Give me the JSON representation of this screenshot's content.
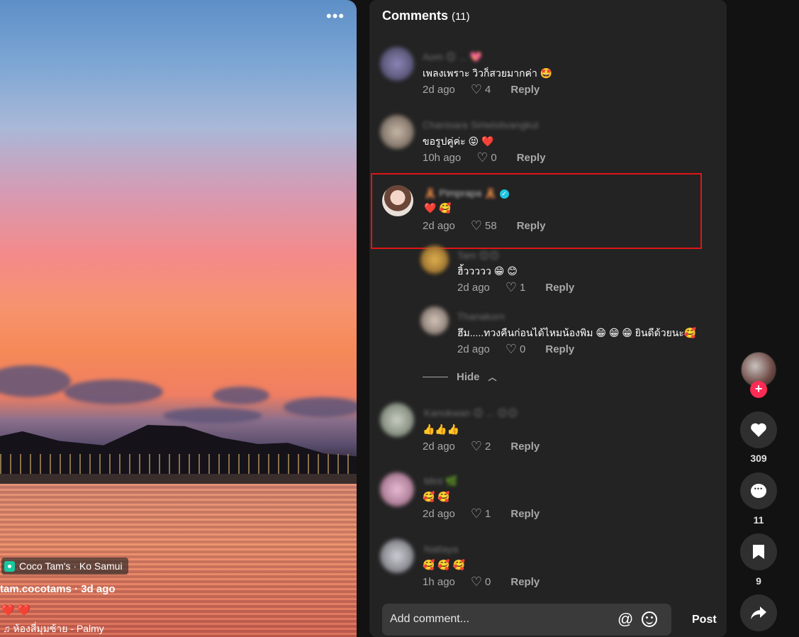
{
  "video": {
    "more_label": "•••",
    "location": "Coco Tam's · Ko Samui",
    "author": "tam.cocotams",
    "posted": " · 3d ago",
    "caption": "❤️ ❤️",
    "music": "♫  ห้องสี่มุมซ้าย - Palmy"
  },
  "comments_panel": {
    "title": "Comments",
    "count": "(11)",
    "comments": [
      {
        "username": "Aom 😊 ... 💖",
        "text": "เพลงเพราะ วิวก็สวยมากค่า 🤩",
        "time": "2d ago",
        "likes": "4",
        "reply": "Reply"
      },
      {
        "username": "Chanisara Siriwisitvangkul",
        "text": "ขอรูปคู่ค่ะ 😝 ❤️",
        "time": "10h ago",
        "likes": "0",
        "reply": "Reply"
      },
      {
        "username": "🧸 Pimprapa 🧸",
        "text": "❤️ 🥰",
        "time": "2d ago",
        "likes": "58",
        "reply": "Reply"
      },
      {
        "username": "Tam 😊😊",
        "text": "ฮิ้ววววว 😁 😊",
        "time": "2d ago",
        "likes": "1",
        "reply": "Reply"
      },
      {
        "username": "Thanakorn",
        "text": "ฮึม.....ทวงคืนก่อนได้ไหมน้องพิม 😁 😁 😁  ยินดีด้วยนะ🥰",
        "time": "2d ago",
        "likes": "0",
        "reply": "Reply"
      },
      {
        "username": "Kanokwan 😊 ... 😊😊",
        "text": "👍👍👍",
        "time": "2d ago",
        "likes": "2",
        "reply": "Reply"
      },
      {
        "username": "Mint 🌿",
        "text": "🥰 🥰",
        "time": "2d ago",
        "likes": "1",
        "reply": "Reply"
      },
      {
        "username": "Nattaya",
        "text": "🥰 🥰 🥰",
        "time": "1h ago",
        "likes": "0",
        "reply": "Reply"
      }
    ],
    "hide_label": "Hide",
    "composer_placeholder": "Add comment...",
    "post_label": "Post"
  },
  "rail": {
    "likes": "309",
    "comments": "11",
    "saves": "9"
  },
  "colors": {
    "accent": "#fe2c55",
    "highlight": "#e01515",
    "verified": "#20c5e0"
  }
}
